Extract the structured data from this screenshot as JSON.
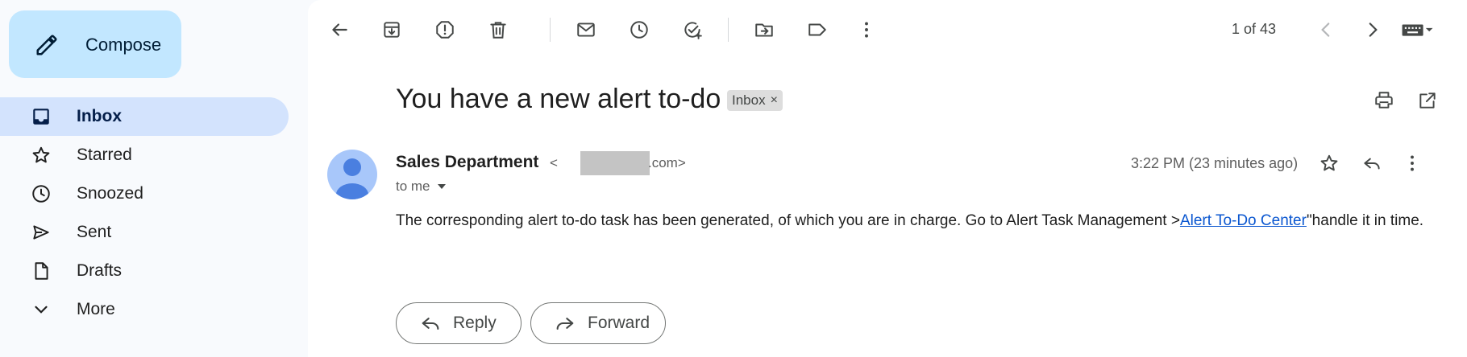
{
  "sidebar": {
    "compose_label": "Compose",
    "items": [
      {
        "label": "Inbox",
        "icon": "inbox-icon",
        "active": true
      },
      {
        "label": "Starred",
        "icon": "star-icon"
      },
      {
        "label": "Snoozed",
        "icon": "clock-icon"
      },
      {
        "label": "Sent",
        "icon": "send-icon"
      },
      {
        "label": "Drafts",
        "icon": "draft-icon"
      },
      {
        "label": "More",
        "icon": "chevron-down-icon"
      }
    ]
  },
  "toolbar": {
    "icons": [
      "back-arrow-icon",
      "archive-icon",
      "report-spam-icon",
      "delete-icon",
      "mark-unread-icon",
      "snooze-icon",
      "add-task-icon",
      "move-to-icon",
      "label-icon",
      "more-vert-icon"
    ],
    "pager_text": "1 of 43"
  },
  "message": {
    "subject": "You have a new alert to-do",
    "label_chip": "Inbox",
    "label_chip_close": "×",
    "sender_name": "Sales Department",
    "sender_email_prefix": "<",
    "sender_email_suffix": ".com>",
    "recipient_text": "to me",
    "timestamp": "3:22 PM (23 minutes ago)",
    "body_before_link": "The corresponding alert to-do task has been generated, of which you are in charge. Go to Alert Task Management >",
    "body_link": "Alert To-Do Center",
    "body_after_link": "\"handle it in time."
  },
  "actions": {
    "reply_label": "Reply",
    "forward_label": "Forward"
  },
  "colors": {
    "compose_bg": "#c2e7ff",
    "active_nav_bg": "#d3e3fd",
    "link": "#0b57d0",
    "avatar_bg": "#a8c7fa",
    "avatar_fg": "#4a7fe0"
  }
}
